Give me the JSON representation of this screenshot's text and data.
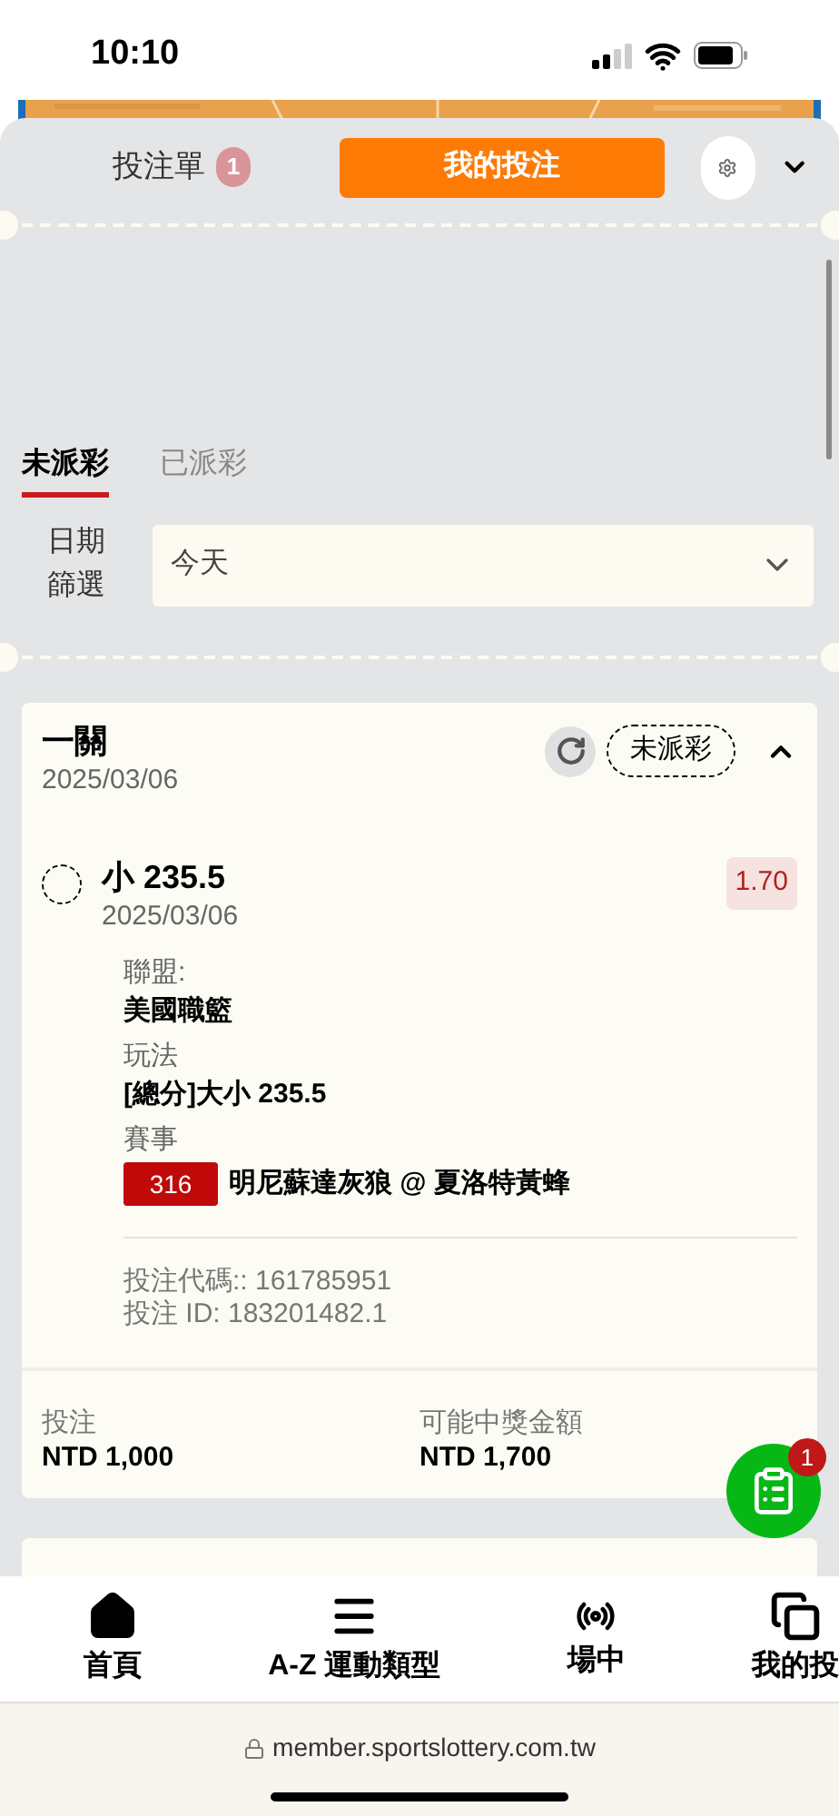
{
  "status_bar": {
    "time": "10:10"
  },
  "header": {
    "betslip_label": "投注單",
    "betslip_count": "1",
    "my_bets_button": "我的投注"
  },
  "tabs": [
    {
      "label": "未派彩",
      "selected": true
    },
    {
      "label": "已派彩",
      "selected": false
    }
  ],
  "date_filter": {
    "label": "日期篩選",
    "value": "今天"
  },
  "bet_card": {
    "title": "一關",
    "date": "2025/03/06",
    "status": "未派彩",
    "expanded": true,
    "selection": {
      "name": "小 235.5",
      "date": "2025/03/06",
      "odds": "1.70"
    },
    "details": [
      {
        "label": "聯盟:",
        "value": "美國職籃"
      },
      {
        "label": "玩法",
        "value": "[總分]大小 235.5"
      }
    ],
    "event": {
      "label": "賽事",
      "number": "316",
      "name": "明尼蘇達灰狼 @ 夏洛特黃蜂"
    },
    "codes": [
      "投注代碼:: 161785951",
      "投注 ID: 183201482.1"
    ],
    "stake": {
      "label": "投注",
      "value": "NTD 1,000"
    },
    "payout": {
      "label": "可能中獎金額",
      "value": "NTD 1,700"
    }
  },
  "fab": {
    "count": "1"
  },
  "bottom_nav": [
    {
      "label": "首頁"
    },
    {
      "label": "A-Z 運動類型"
    },
    {
      "label": "場中"
    },
    {
      "label": "我的投"
    }
  ],
  "url": "member.sportslottery.com.tw"
}
